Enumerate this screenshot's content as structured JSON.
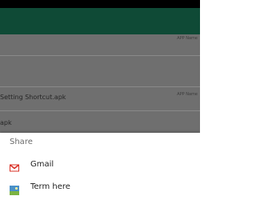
{
  "list": {
    "tag_label": "APP Name",
    "items": [
      {
        "title": ""
      },
      {
        "title": "Setting Shortcut.apk"
      },
      {
        "title": "apk"
      }
    ]
  },
  "share_sheet": {
    "title": "Share",
    "options": [
      {
        "label": "Gmail",
        "icon": "gmail-icon"
      },
      {
        "label": "Term here",
        "icon": "term-here-icon"
      }
    ]
  },
  "colors": {
    "status_bar": "#000000",
    "app_bar": "#0f4a36",
    "scrim_background": "#6f6f6f",
    "sheet_background": "#ffffff",
    "gmail_red": "#d93025"
  }
}
